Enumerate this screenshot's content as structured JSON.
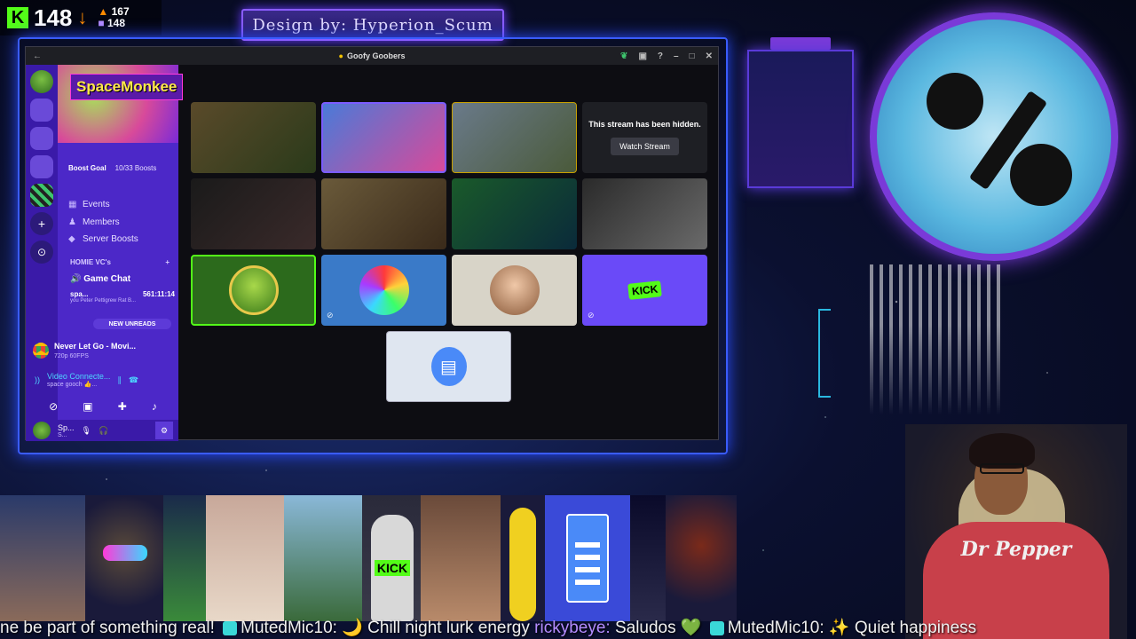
{
  "stream_stats": {
    "viewer_count": "148",
    "kick_icon": "K",
    "followers_up": "167",
    "viewers_alt": "148"
  },
  "banner": {
    "text": "Design by: Hyperion_Scum"
  },
  "window": {
    "title": "Goofy Goobers",
    "back_icon": "←",
    "controls": [
      "leaf-icon",
      "window-icon",
      "help-icon",
      "minimize-icon",
      "maximize-icon",
      "close-icon"
    ]
  },
  "sidebar": {
    "server_name": "SpaceMonkee",
    "boost_goal": "Boost Goal",
    "boost_count": "10/33 Boosts",
    "nav": [
      {
        "label": "Events",
        "icon": "calendar-icon"
      },
      {
        "label": "Members",
        "icon": "members-icon"
      },
      {
        "label": "Server Boosts",
        "icon": "boost-icon"
      }
    ],
    "vc_category": "HOMIE VC's",
    "voice_channel": "Game Chat",
    "user_name": "spa...",
    "user_time": "561:11:14",
    "user_activity": "you Peter Pettigrew Rat B...",
    "new_unreads": "NEW UNREADS",
    "activity_title": "Never Let Go - Movi...",
    "activity_sub": "720p 60FPS",
    "voice_status": "Video Connecte...",
    "voice_server": "space gooch 👍...",
    "current_user": "Sp...",
    "current_user_sub": "S..."
  },
  "tiles": {
    "hidden_message": "This stream has been hidden.",
    "watch_button": "Watch Stream"
  },
  "ticker": {
    "text_1": "ne be part of something real!",
    "user_1": "MutedMic10:",
    "text_2": "🌙 Chill night lurk energy",
    "user_2": "rickybeye:",
    "text_3": "Saludos 💚",
    "user_3": "MutedMic10:",
    "text_4": "✨ Quiet happiness"
  },
  "webcam": {
    "shirt_logo": "Dr Pepper"
  },
  "colors": {
    "kick_green": "#53fc18",
    "discord_purple": "#4c28c8",
    "accent_orange": "#ff8a00"
  }
}
